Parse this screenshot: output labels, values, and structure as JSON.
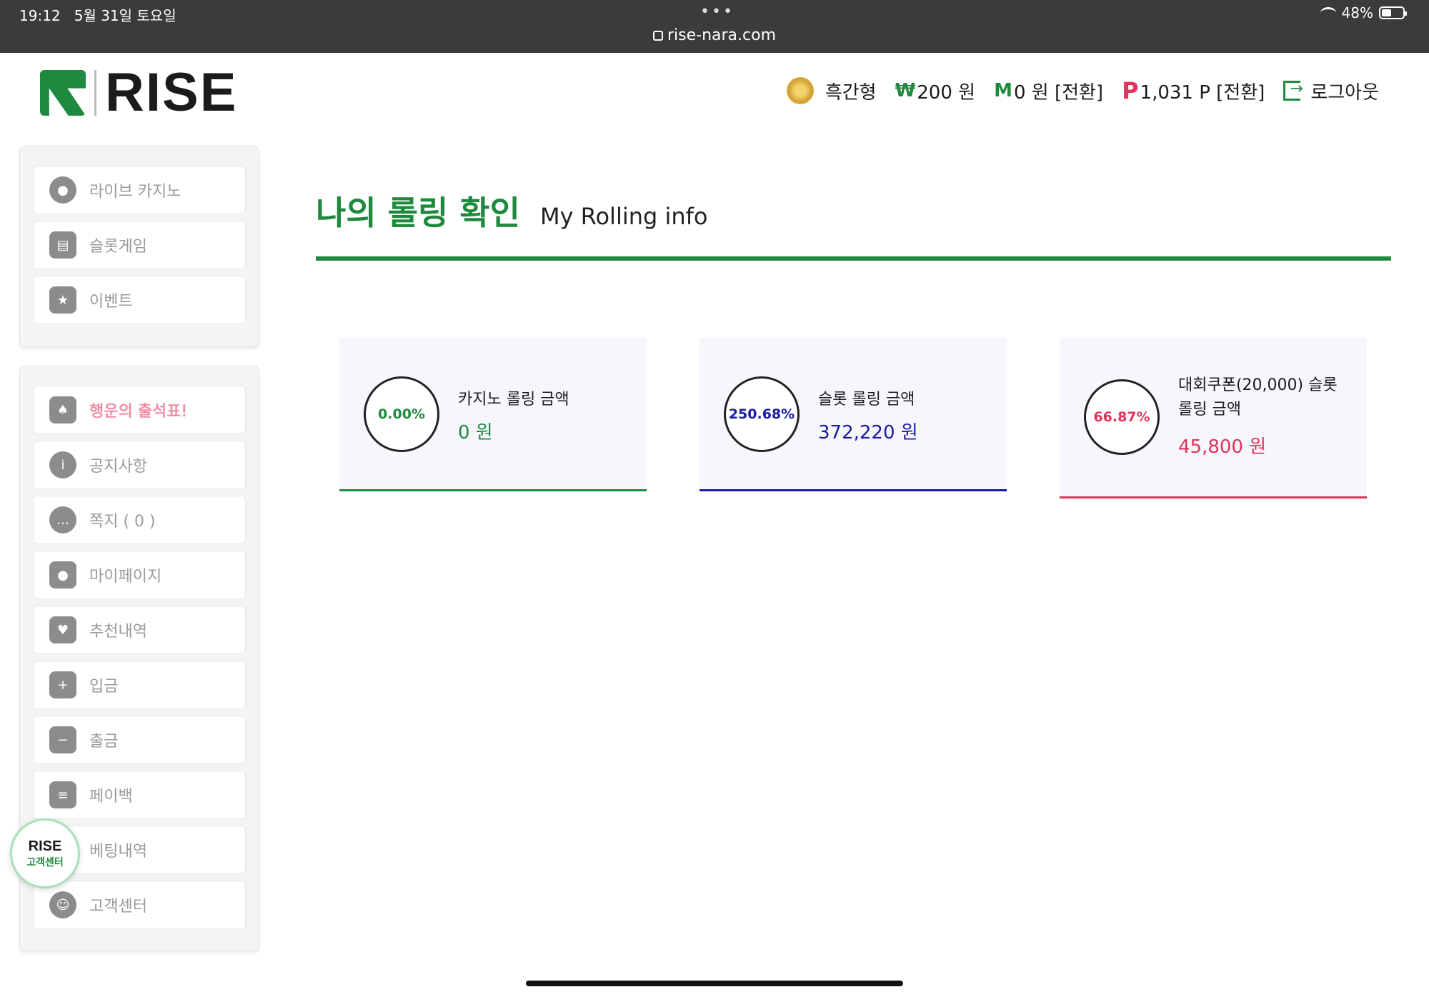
{
  "statusbar": {
    "time": "19:12",
    "date": "5월 31일 토요일",
    "url": "rise-nara.com",
    "battery": "48%",
    "battery_fraction": 0.48
  },
  "header": {
    "logo_text": "RISE",
    "user_name": "흑간형",
    "cash": {
      "symbol": "₩",
      "amount": "200 원"
    },
    "money": {
      "symbol": "M",
      "amount": "0 원 [전환]"
    },
    "points": {
      "symbol": "P",
      "amount": "1,031 P [전환]"
    },
    "logout": "로그아웃"
  },
  "sidebar": {
    "group1": [
      {
        "label": "라이브 카지노",
        "icon": "casino-chips-icon"
      },
      {
        "label": "슬롯게임",
        "icon": "slot-machine-icon"
      },
      {
        "label": "이벤트",
        "icon": "star-icon"
      }
    ],
    "group2": [
      {
        "label": "행운의 출석표!",
        "icon": "calendar-icon"
      },
      {
        "label": "공지사항",
        "icon": "info-icon"
      },
      {
        "label": "쪽지 ( 0 )",
        "icon": "message-icon"
      },
      {
        "label": "마이페이지",
        "icon": "user-icon"
      },
      {
        "label": "추천내역",
        "icon": "heart-mail-icon"
      },
      {
        "label": "입금",
        "icon": "wallet-in-icon"
      },
      {
        "label": "출금",
        "icon": "wallet-out-icon"
      },
      {
        "label": "페이백",
        "icon": "coins-icon"
      },
      {
        "label": "베팅내역",
        "icon": "betting-icon"
      },
      {
        "label": "고객센터",
        "icon": "support-icon"
      }
    ]
  },
  "main": {
    "title_ko": "나의 롤링 확인",
    "title_en": "My Rolling info",
    "cards": [
      {
        "percent": "0.00%",
        "label": "카지노 롤링 금액",
        "amount": "0 원",
        "color": "#1f8a3f"
      },
      {
        "percent": "250.68%",
        "label": "슬롯 롤링 금액",
        "amount": "372,220 원",
        "color": "#1a1aa3"
      },
      {
        "percent": "66.87%",
        "label": "대회쿠폰(20,000) 슬롯 롤링 금액",
        "amount": "45,800 원",
        "color": "#e0345a"
      }
    ]
  },
  "support_badge": {
    "title": "RISE",
    "subtitle": "고객센터"
  }
}
